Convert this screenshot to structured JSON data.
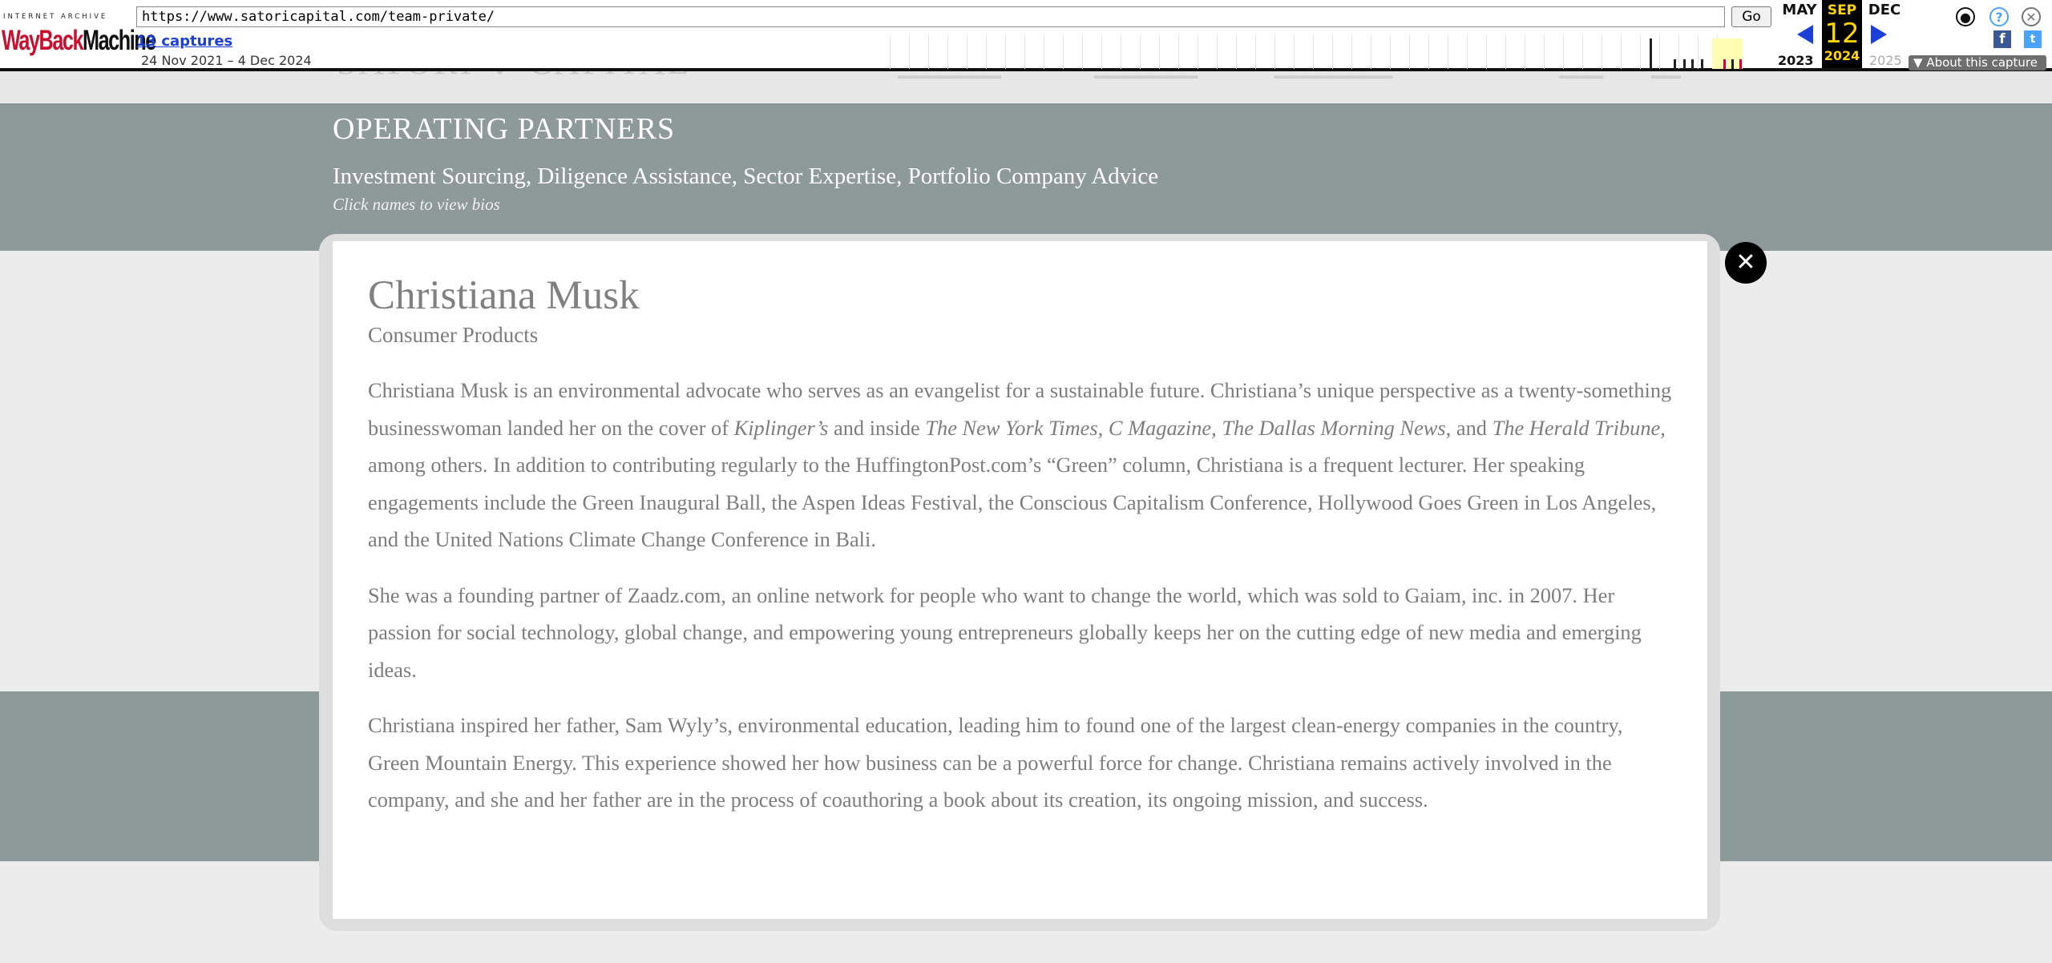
{
  "wayback": {
    "brand_top": "INTERNET ARCHIVE",
    "brand_wayback": "WayBack",
    "brand_machine": "Machine",
    "url": "https://www.satoricapital.com/team-private/",
    "go_label": "Go",
    "captures_link": "13 captures",
    "date_range": "24 Nov 2021 – 4 Dec 2024",
    "prev_month": "MAY",
    "current_month": "SEP",
    "current_day": "12",
    "next_month": "DEC",
    "prev_year": "2023",
    "current_year": "2024",
    "next_year": "2025",
    "about_label": "About this capture",
    "icons": [
      "user-account-icon",
      "help-icon",
      "close-icon",
      "facebook-icon",
      "twitter-icon"
    ],
    "accent_color": "#1b3fd8",
    "highlight_color": "#ffd400"
  },
  "site": {
    "logo_text": "SATORI ✻ CAPITAL",
    "hero_title": "OPERATING PARTNERS",
    "hero_subtitle": "Investment Sourcing, Diligence Assistance, Sector Expertise, Portfolio Company Advice",
    "hero_hint": "Click names to view bios",
    "band_color": "#8e999a"
  },
  "modal": {
    "name": "Christiana Musk",
    "sector": "Consumer Products",
    "close_icon": "close-icon",
    "bio": {
      "p1_a": "Christiana Musk is an environmental advocate who serves as an evangelist for a sustainable future. Christiana’s unique perspective as a twenty-something businesswoman landed her on the cover of ",
      "p1_em1": "Kiplinger’s",
      "p1_b": " and inside ",
      "p1_em2": "The New York Times, C Magazine, The Dallas Morning News",
      "p1_c": ", and ",
      "p1_em3": "The Herald Tribune",
      "p1_d": ", among others. In addition to contributing regularly to the HuffingtonPost.com’s “Green” column, Christiana is a frequent lecturer. Her speaking engagements include the Green Inaugural Ball, the Aspen Ideas Festival, the Conscious Capitalism Conference, Hollywood Goes Green in Los Angeles, and the United Nations Climate Change Conference in Bali.",
      "p2": "She was a founding partner of Zaadz.com, an online network for people who want to change the world, which was sold to Gaiam, inc. in 2007. Her passion for social technology, global change, and empowering young entrepreneurs globally keeps her on the cutting edge of new media and emerging ideas.",
      "p3": "Christiana inspired her father, Sam Wyly’s, environmental education, leading him to found one of the largest clean-energy companies in the country, Green Mountain Energy. This experience showed her how business can be a powerful force for change. Christiana remains actively involved in the company, and she and her father are in the process of coauthoring a book about its creation, its ongoing mission, and success."
    }
  }
}
